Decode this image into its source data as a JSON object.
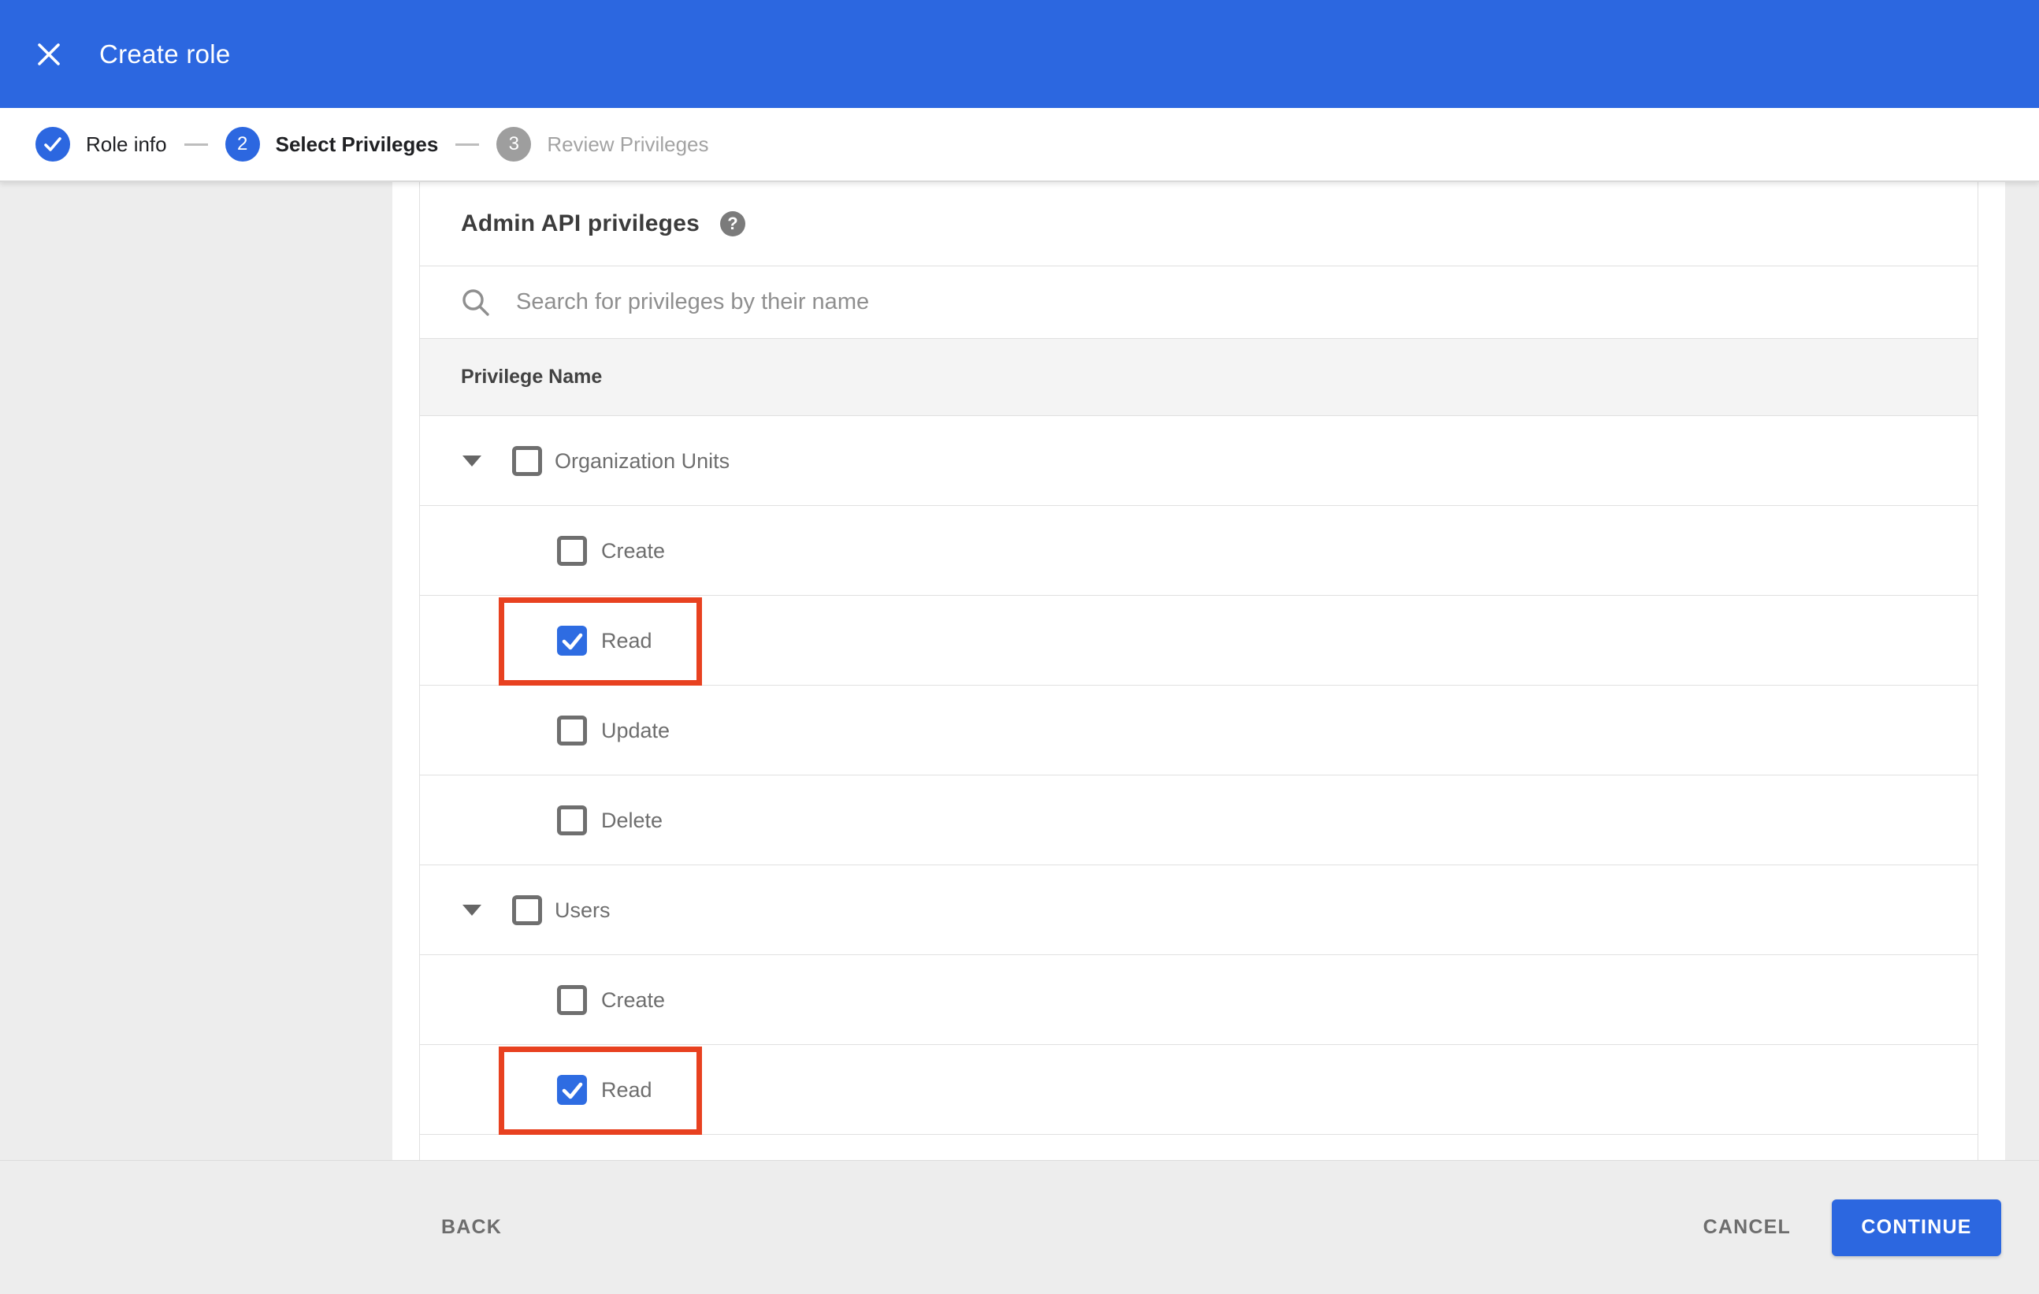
{
  "header": {
    "title": "Create role",
    "close_icon": "x-cross",
    "bar_color": "#2c67e0"
  },
  "stepper": {
    "steps": [
      {
        "number": "1",
        "label": "Role info",
        "state": "complete",
        "indicator": "checkmark"
      },
      {
        "number": "2",
        "label": "Select Privileges",
        "state": "active",
        "indicator": "2"
      },
      {
        "number": "3",
        "label": "Review Privileges",
        "state": "upcoming",
        "indicator": "3"
      }
    ]
  },
  "panel": {
    "heading": "Admin API privileges",
    "help_icon": "question-mark-circle",
    "help_glyph": "?",
    "search": {
      "icon": "magnifier",
      "placeholder": "Search for privileges by their name",
      "value": ""
    },
    "table": {
      "column_header": "Privilege Name",
      "groups": [
        {
          "label": "Organization Units",
          "expanded": true,
          "checked": false,
          "expand_icon": "triangle-down",
          "children": [
            {
              "label": "Create",
              "checked": false,
              "highlighted": false
            },
            {
              "label": "Read",
              "checked": true,
              "highlighted": true
            },
            {
              "label": "Update",
              "checked": false,
              "highlighted": false
            },
            {
              "label": "Delete",
              "checked": false,
              "highlighted": false
            }
          ]
        },
        {
          "label": "Users",
          "expanded": true,
          "checked": false,
          "expand_icon": "triangle-down",
          "children": [
            {
              "label": "Create",
              "checked": false,
              "highlighted": false
            },
            {
              "label": "Read",
              "checked": true,
              "highlighted": true
            }
          ]
        }
      ]
    }
  },
  "footer": {
    "back_label": "BACK",
    "cancel_label": "CANCEL",
    "continue_label": "CONTINUE"
  },
  "colors": {
    "accent_blue": "#2c67e0",
    "checkbox_blue": "#2e6ce2",
    "highlight_red": "#e84120",
    "page_background": "#ededed"
  }
}
